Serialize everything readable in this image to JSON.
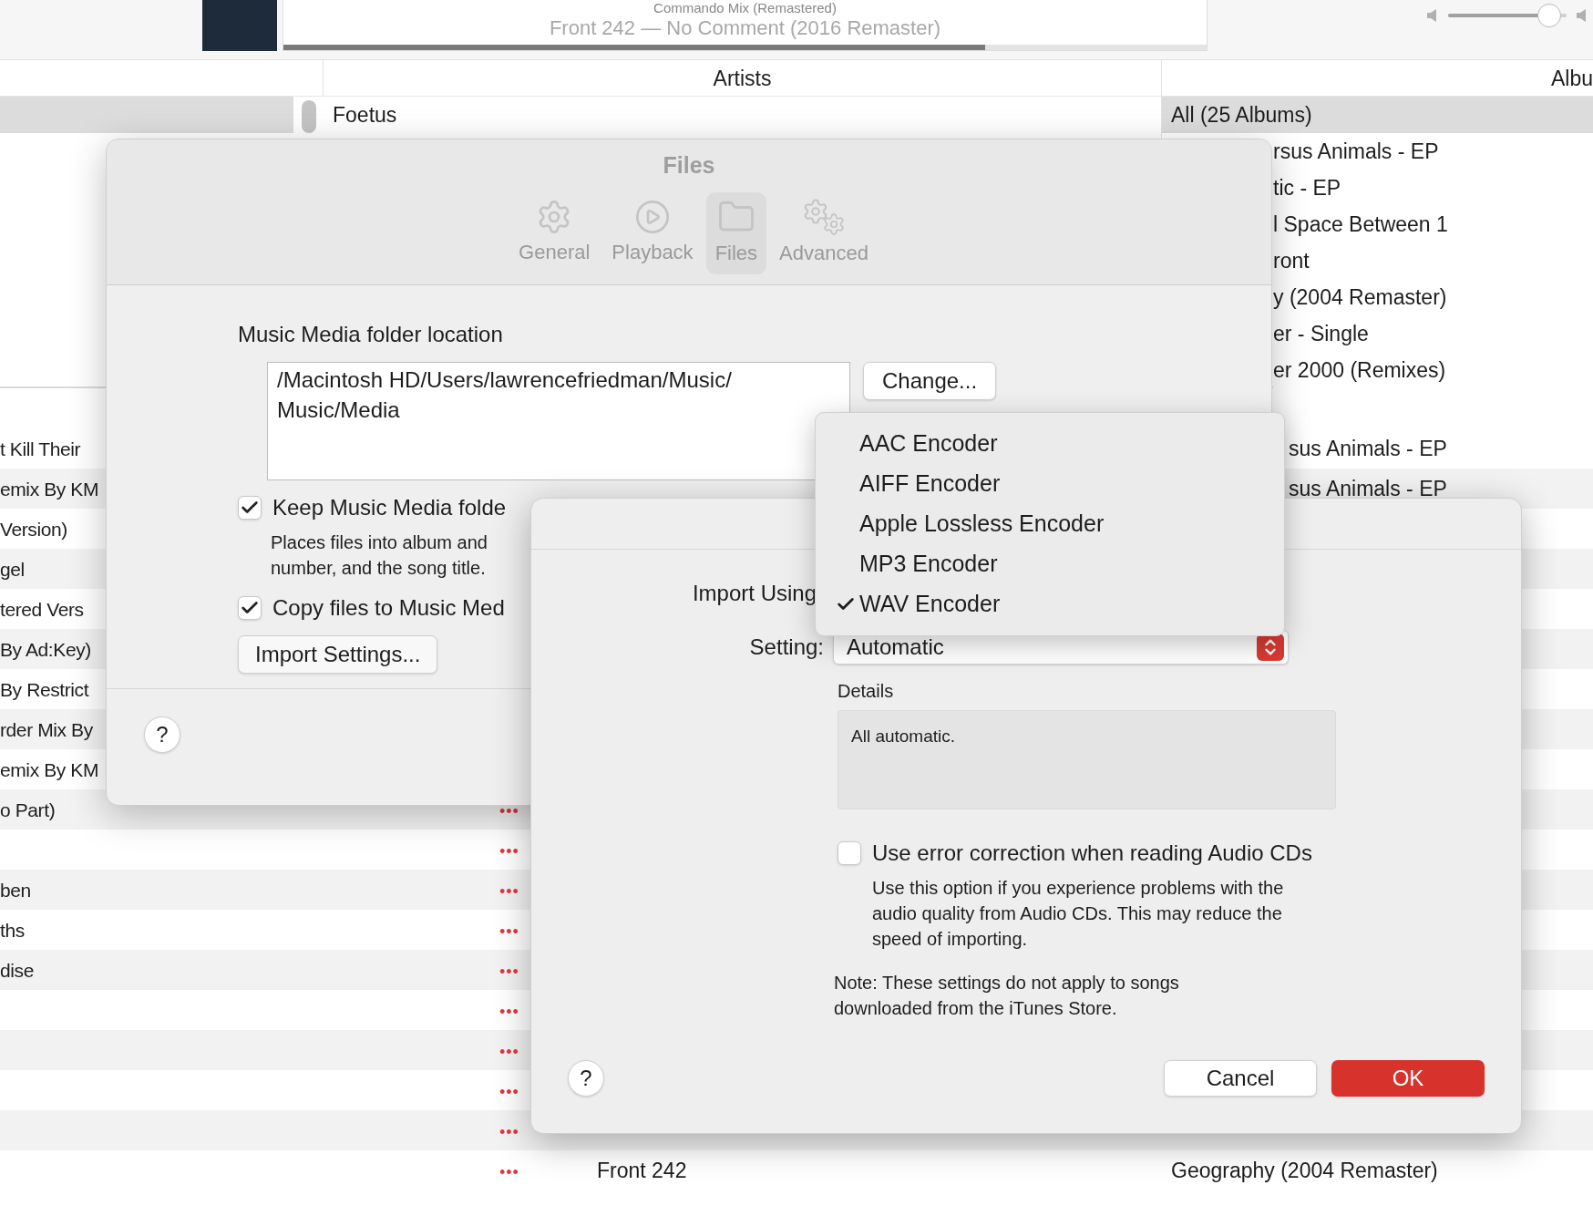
{
  "now_playing": {
    "title": "Commando Mix (Remastered)",
    "subtitle": "Front 242 — No Comment (2016 Remaster)",
    "level": 0.76
  },
  "volume": {
    "level": 0.9
  },
  "browser": {
    "columns": [
      "Artists",
      "Albu"
    ],
    "artists": [
      {
        "name": "Foetus",
        "selected": false
      }
    ],
    "albums": [
      {
        "name": "All (25 Albums)",
        "selected": true
      },
      {
        "name": "rsus Animals - EP",
        "selected": false
      },
      {
        "name": "tic - EP",
        "selected": false
      },
      {
        "name": "l Space Between 1",
        "selected": false
      },
      {
        "name": "ront",
        "selected": false
      },
      {
        "name": "y (2004 Remaster)",
        "selected": false
      },
      {
        "name": "er - Single",
        "selected": false
      },
      {
        "name": "er 2000 (Remixes)",
        "selected": false
      }
    ]
  },
  "songs": [
    {
      "title": "t Kill Their",
      "album": "sus Animals - EP"
    },
    {
      "title": "emix By KM",
      "album": "sus Animals - EP"
    },
    {
      "title": "Version)"
    },
    {
      "title": "gel"
    },
    {
      "title": "tered Vers"
    },
    {
      "title": "By Ad:Key)"
    },
    {
      "title": "By Restrict"
    },
    {
      "title": "rder Mix By"
    },
    {
      "title": "emix By KM"
    },
    {
      "title": "o Part)",
      "more": "•••"
    },
    {
      "more": "•••"
    },
    {
      "title": "ben",
      "more": "•••"
    },
    {
      "title": "ths",
      "more": "•••"
    },
    {
      "title": "dise",
      "more": "•••"
    },
    {
      "more": "•••"
    },
    {
      "more": "•••"
    },
    {
      "more": "•••"
    },
    {
      "more": "•••"
    },
    {
      "artist": "Front 242",
      "album": "Geography (2004 Remaster)",
      "more": "•••"
    }
  ],
  "files_dialog": {
    "title": "Files",
    "tabs": [
      {
        "label": "General",
        "kind": "gear",
        "selected": false
      },
      {
        "label": "Playback",
        "kind": "play",
        "selected": false
      },
      {
        "label": "Files",
        "kind": "folder",
        "selected": true
      },
      {
        "label": "Advanced",
        "kind": "gears",
        "selected": false
      }
    ],
    "folder_label": "Music Media folder location",
    "folder_path": "/Macintosh HD/Users/lawrencefriedman/Music/\nMusic/Media",
    "change_button": "Change...",
    "options": [
      {
        "label": "Keep Music Media folde",
        "checked": true,
        "description": "Places files into album and\nnumber, and the song title."
      },
      {
        "label": "Copy files to Music Med",
        "checked": true
      }
    ],
    "import_button": "Import Settings...",
    "help": "?"
  },
  "import_dialog": {
    "import_using_label": "Import Using",
    "encoders": [
      {
        "label": "AAC Encoder",
        "selected": false
      },
      {
        "label": "AIFF Encoder",
        "selected": false
      },
      {
        "label": "Apple Lossless Encoder",
        "selected": false
      },
      {
        "label": "MP3 Encoder",
        "selected": false
      },
      {
        "label": "WAV Encoder",
        "selected": true
      }
    ],
    "setting_label": "Setting:",
    "setting_value": "Automatic",
    "details_label": "Details",
    "details_text": "All automatic.",
    "error_correction": {
      "label": "Use error correction when reading Audio CDs",
      "checked": false,
      "description": "Use this option if you experience problems with the\naudio quality from Audio CDs. This may reduce the\nspeed of importing."
    },
    "note": "Note: These settings do not apply to songs\ndownloaded from the iTunes Store.",
    "help": "?",
    "buttons": [
      {
        "label": "Cancel",
        "kind": "normal"
      },
      {
        "label": "OK",
        "kind": "default"
      }
    ]
  }
}
